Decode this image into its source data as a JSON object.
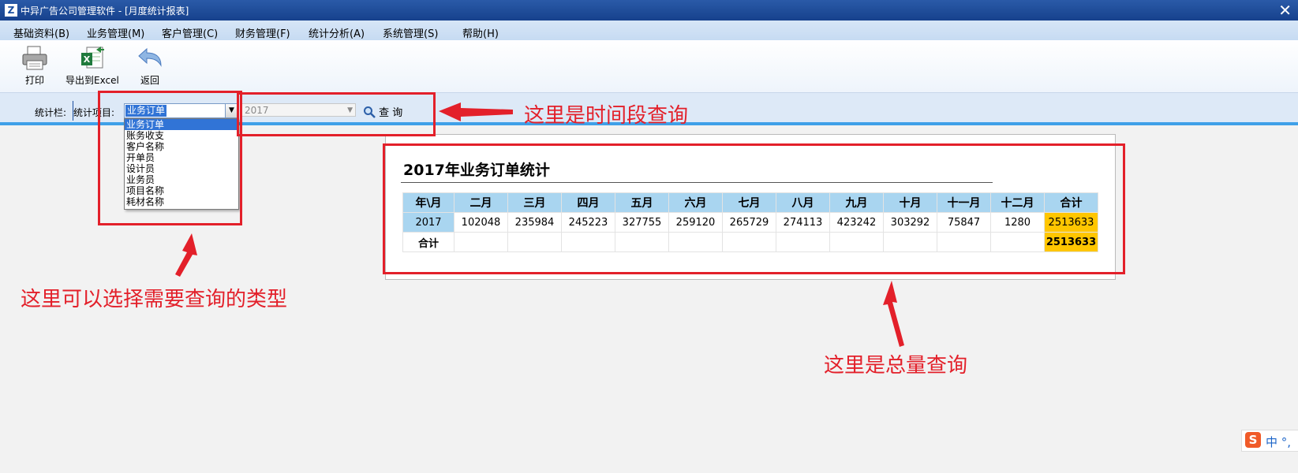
{
  "window": {
    "title": "中异广告公司管理软件 - [月度统计报表]",
    "close_glyph": "✕"
  },
  "menu": [
    "基础资料(B)",
    "业务管理(M)",
    "客户管理(C)",
    "财务管理(F)",
    "统计分析(A)",
    "系统管理(S)",
    "帮助(H)"
  ],
  "toolbar": {
    "print": "打印",
    "export": "导出到Excel",
    "back": "返回"
  },
  "query": {
    "bar_label": "统计栏:",
    "item_label": "统计项目:",
    "selected": "业务订单",
    "year": "2017",
    "search_label": "查 询",
    "options": [
      "业务订单",
      "账务收支",
      "客户名称",
      "开单员",
      "设计员",
      "业务员",
      "项目名称",
      "耗材名称"
    ]
  },
  "report": {
    "title": "2017年业务订单统计",
    "headers": [
      "年\\月",
      "二月",
      "三月",
      "四月",
      "五月",
      "六月",
      "七月",
      "八月",
      "九月",
      "十月",
      "十一月",
      "十二月",
      "合计"
    ],
    "row": {
      "year": "2017",
      "values": [
        "102048",
        "235984",
        "245223",
        "327755",
        "259120",
        "265729",
        "274113",
        "423242",
        "303292",
        "75847",
        "1280"
      ],
      "total": "2513633"
    },
    "sum_row": {
      "label": "合计",
      "total": "2513633"
    }
  },
  "annotations": {
    "time_query": "这里是时间段查询",
    "type_select": "这里可以选择需要查询的类型",
    "total_query": "这里是总量查询"
  },
  "ime": {
    "logo": "S",
    "mode": "中 °,"
  },
  "colors": {
    "annotation_red": "#e3202a",
    "header_blue": "#a9d5f0",
    "total_gold": "#ffc600",
    "title_bar": "#1b4fa0"
  }
}
